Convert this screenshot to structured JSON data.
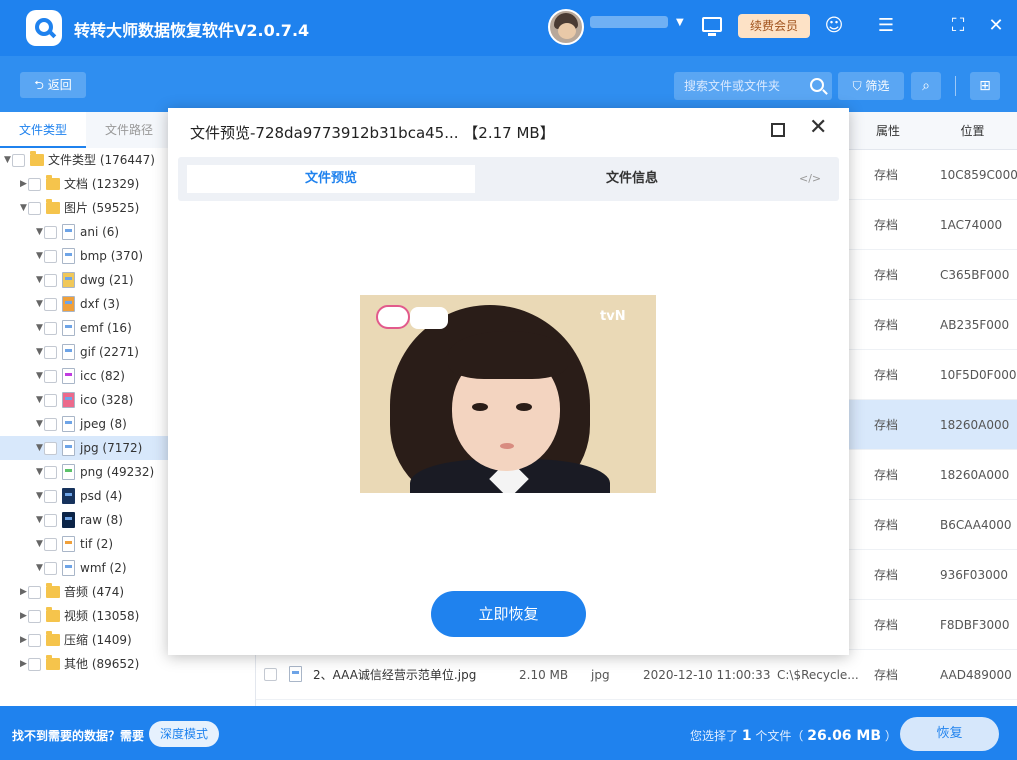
{
  "app": {
    "title": "转转大师数据恢复软件V2.0.7.4",
    "vip_label": "续费会员"
  },
  "toolbar": {
    "back_label": "返回",
    "search_placeholder": "搜索文件或文件夹",
    "filter_label": "筛选"
  },
  "left": {
    "tabs": [
      "文件类型",
      "文件路径"
    ],
    "tree": [
      {
        "label": "文件类型 (176447)",
        "kind": "folder",
        "level": 0,
        "expand": "▼"
      },
      {
        "label": "文档 (12329)",
        "kind": "folder",
        "level": 1,
        "expand": "▶"
      },
      {
        "label": "图片 (59525)",
        "kind": "folder",
        "level": 1,
        "expand": "▼"
      },
      {
        "label": "ani (6)",
        "kind": "ani",
        "level": 2,
        "expand": "▼"
      },
      {
        "label": "bmp (370)",
        "kind": "bmp",
        "level": 2,
        "expand": "▼"
      },
      {
        "label": "dwg (21)",
        "kind": "dwg",
        "level": 2,
        "expand": "▼"
      },
      {
        "label": "dxf (3)",
        "kind": "dxf",
        "level": 2,
        "expand": "▼"
      },
      {
        "label": "emf (16)",
        "kind": "emf",
        "level": 2,
        "expand": "▼"
      },
      {
        "label": "gif (2271)",
        "kind": "gif",
        "level": 2,
        "expand": "▼"
      },
      {
        "label": "icc (82)",
        "kind": "icc",
        "level": 2,
        "expand": "▼"
      },
      {
        "label": "ico (328)",
        "kind": "ico",
        "level": 2,
        "expand": "▼"
      },
      {
        "label": "jpeg (8)",
        "kind": "jpeg",
        "level": 2,
        "expand": "▼"
      },
      {
        "label": "jpg (7172)",
        "kind": "jpg",
        "level": 2,
        "expand": "▼",
        "selected": true
      },
      {
        "label": "png (49232)",
        "kind": "png",
        "level": 2,
        "expand": "▼"
      },
      {
        "label": "psd (4)",
        "kind": "psd",
        "level": 2,
        "expand": "▼"
      },
      {
        "label": "raw (8)",
        "kind": "raw",
        "level": 2,
        "expand": "▼"
      },
      {
        "label": "tif (2)",
        "kind": "tif",
        "level": 2,
        "expand": "▼"
      },
      {
        "label": "wmf (2)",
        "kind": "wmf",
        "level": 2,
        "expand": "▼"
      },
      {
        "label": "音频 (474)",
        "kind": "folder",
        "level": 1,
        "expand": "▶"
      },
      {
        "label": "视频 (13058)",
        "kind": "folder",
        "level": 1,
        "expand": "▶"
      },
      {
        "label": "压缩 (1409)",
        "kind": "folder",
        "level": 1,
        "expand": "▶"
      },
      {
        "label": "其他 (89652)",
        "kind": "folder",
        "level": 1,
        "expand": "▶"
      }
    ]
  },
  "table": {
    "headers": {
      "attr": "属性",
      "pos": "位置"
    },
    "rows": [
      {
        "attr": "存档",
        "pos": "10C859C000"
      },
      {
        "attr": "存档",
        "pos": "1AC74000"
      },
      {
        "attr": "存档",
        "pos": "C365BF000"
      },
      {
        "attr": "存档",
        "pos": "AB235F000"
      },
      {
        "attr": "存档",
        "pos": "10F5D0F000"
      },
      {
        "attr": "存档",
        "pos": "18260A000",
        "selected": true
      },
      {
        "attr": "存档",
        "pos": "18260A000"
      },
      {
        "attr": "存档",
        "pos": "B6CAA4000"
      },
      {
        "attr": "存档",
        "pos": "936F03000"
      },
      {
        "attr": "存档",
        "pos": "F8DBF3000"
      }
    ],
    "last_row": {
      "name": "2、AAA诚信经营示范单位.jpg",
      "size": "2.10 MB",
      "type": "jpg",
      "date": "2020-12-10 11:00:33",
      "path": "C:\\$Recycle...",
      "attr": "存档",
      "pos": "AAD489000"
    }
  },
  "modal": {
    "title": "文件预览-728da9773912b31bca45... 【2.17 MB】",
    "tab_preview": "文件预览",
    "tab_info": "文件信息",
    "code_icon": "</>",
    "image_overlay": "tvN",
    "recover_label": "立即恢复"
  },
  "bottom": {
    "hint": "找不到需要的数据？需要",
    "deep_mode": "深度模式",
    "selected_prefix": "您选择了",
    "selected_count": "1",
    "selected_mid": "个文件（",
    "selected_size": "26.06 MB",
    "selected_suffix": "）",
    "recover_label": "恢复"
  }
}
